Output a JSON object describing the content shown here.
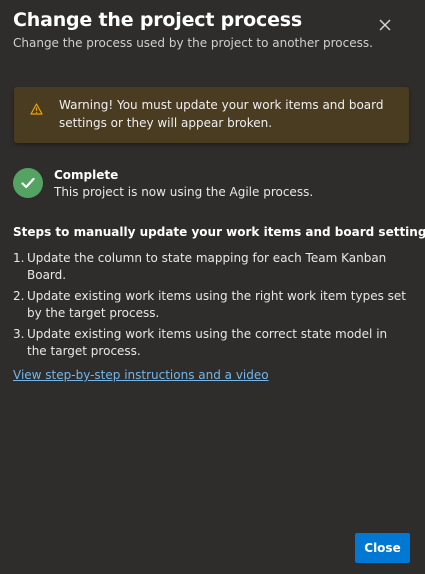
{
  "dialog": {
    "title": "Change the project process",
    "subtitle": "Change the process used by the project to another process.",
    "close_icon": "close-icon"
  },
  "warning": {
    "icon": "warning-icon",
    "text": "Warning! You must update your work items and board settings or they will appear broken.",
    "color": "#4a3c21",
    "icon_color": "#f0a30a"
  },
  "status": {
    "icon": "checkmark-icon",
    "title": "Complete",
    "description": "This project is now using the Agile process.",
    "color": "#55a362"
  },
  "steps": {
    "heading": "Steps to manually update your work items and board settings:",
    "items": [
      {
        "num": "1.",
        "text": "Update the column to state mapping for each Team Kanban Board."
      },
      {
        "num": "2.",
        "text": "Update existing work items using the right work item types set by the target process."
      },
      {
        "num": "3.",
        "text": "Update existing work items using the correct state model in the target process."
      }
    ]
  },
  "link": {
    "label": "View step-by-step instructions and a video"
  },
  "footer": {
    "close_label": "Close",
    "accent": "#0078d4"
  }
}
